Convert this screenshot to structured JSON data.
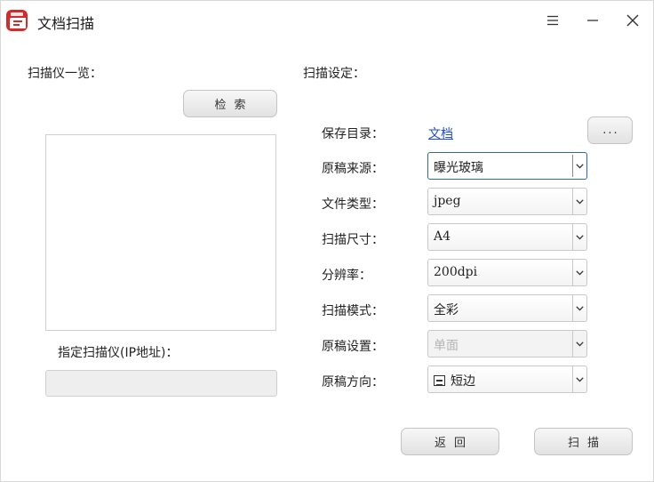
{
  "window": {
    "title": "文档扫描"
  },
  "left": {
    "section_title": "扫描仪一览：",
    "search_button": "检索",
    "ip_label": "指定扫描仪(IP地址)：",
    "ip_value": ""
  },
  "right": {
    "section_title": "扫描设定：",
    "save_dir_label": "保存目录：",
    "save_dir_link": "文档",
    "browse_button": "...",
    "settings": [
      {
        "label": "原稿来源：",
        "value": "曝光玻璃"
      },
      {
        "label": "文件类型：",
        "value": "jpeg"
      },
      {
        "label": "扫描尺寸：",
        "value": "A4"
      },
      {
        "label": "分辨率：",
        "value": "200dpi"
      },
      {
        "label": "扫描模式：",
        "value": "全彩"
      },
      {
        "label": "原稿设置：",
        "value": "单面"
      },
      {
        "label": "原稿方向：",
        "value": "短边"
      }
    ]
  },
  "footer": {
    "back_button": "返回",
    "scan_button": "扫描"
  },
  "colors": {
    "accent": "#d42a2a",
    "link": "#1f4ec8",
    "focus_border": "#2b66c7"
  }
}
